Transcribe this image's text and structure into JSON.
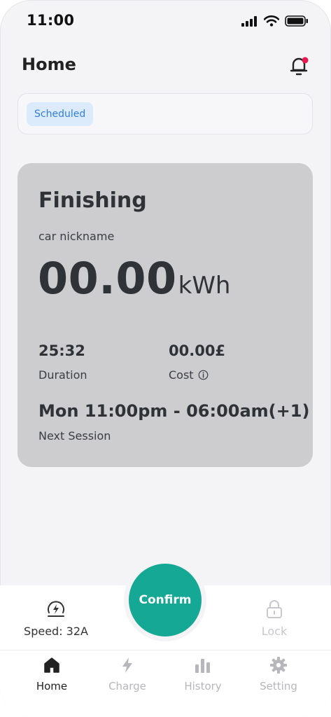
{
  "status_bar": {
    "time": "11:00"
  },
  "header": {
    "title": "Home"
  },
  "schedule": {
    "chip_label": "Scheduled"
  },
  "session_card": {
    "status": "Finishing",
    "car_nickname": "car nickname",
    "energy_value": "00.00",
    "energy_unit": "kWh",
    "duration_value": "25:32",
    "duration_label": "Duration",
    "cost_value": "00.00£",
    "cost_label": "Cost",
    "next_session_value": "Mon 11:00pm - 06:00am(+1)",
    "next_session_label": "Next Session"
  },
  "actions": {
    "speed_label": "Speed: 32A",
    "confirm_label": "Confirm",
    "lock_label": "Lock"
  },
  "tabs": [
    {
      "label": "Home",
      "icon": "home-icon",
      "active": true
    },
    {
      "label": "Charge",
      "icon": "bolt-icon",
      "active": false
    },
    {
      "label": "History",
      "icon": "bar-chart-icon",
      "active": false
    },
    {
      "label": "Setting",
      "icon": "gear-icon",
      "active": false
    }
  ],
  "colors": {
    "accent": "#15a894",
    "card_bg": "#cdcdd0",
    "chip_bg": "#dcebfb",
    "chip_text": "#2f7fd8",
    "notification_dot": "#e5194f"
  }
}
